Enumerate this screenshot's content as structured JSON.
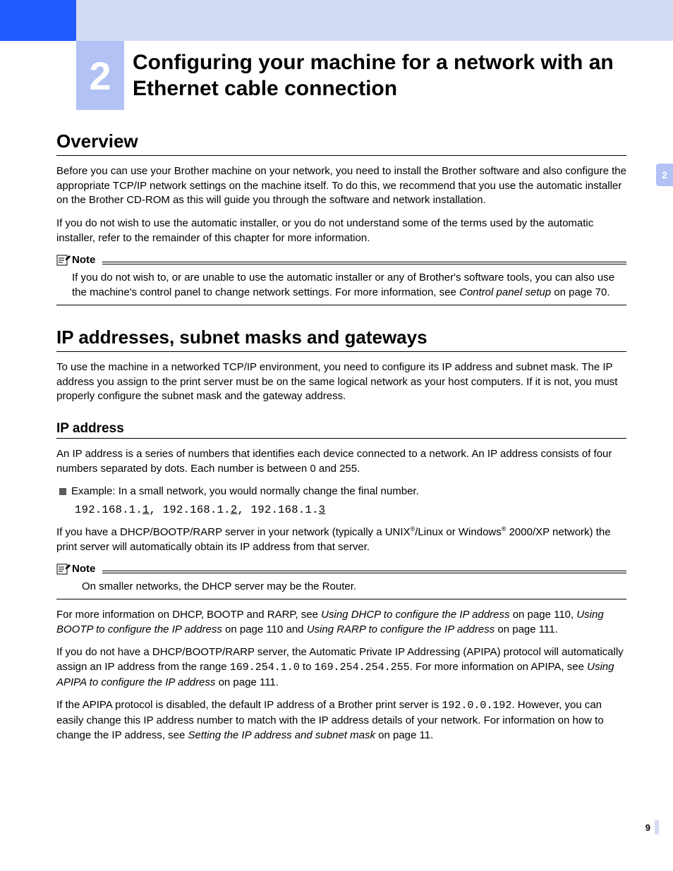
{
  "chapter": {
    "number": "2",
    "title": "Configuring your machine for a network with an Ethernet cable connection"
  },
  "sideTab": "2",
  "pageNumber": "9",
  "overview": {
    "heading": "Overview",
    "p1": "Before you can use your Brother machine on your network, you need to install the Brother software and also configure the appropriate TCP/IP network settings on the machine itself. To do this, we recommend that you use the automatic installer on the Brother CD-ROM as this will guide you through the software and network installation.",
    "p2": "If you do not wish to use the automatic installer, or you do not understand some of the terms used by the automatic installer, refer to the remainder of this chapter for more information.",
    "noteLabel": "Note",
    "note": {
      "pre": "If you do not wish to, or are unable to use the automatic installer or any of Brother's software tools, you can also use the machine's control panel to change network settings. For more information, see ",
      "ref": "Control panel setup",
      "post": " on page 70."
    }
  },
  "ip": {
    "heading": "IP addresses, subnet masks and gateways",
    "intro": "To use the machine in a networked TCP/IP environment, you need to configure its IP address and subnet mask. The IP address you assign to the print server must be on the same logical network as your host computers. If it is not, you must properly configure the subnet mask and the gateway address.",
    "sub": "IP address",
    "sub_p1": "An IP address is a series of numbers that identifies each device connected to a network. An IP address consists of four numbers separated by dots. Each number is between 0 and 255.",
    "bullet": "Example: In a small network, you would normally change the final number.",
    "ipline": {
      "p1a": "192.168.1.",
      "p1u": "1",
      "p2a": "192.168.1.",
      "p2u": "2",
      "p3a": "192.168.1.",
      "p3u": "3",
      "sep": ", "
    },
    "dhcp_p_pre": "If you have a DHCP/BOOTP/RARP server in your network (typically a UNIX",
    "dhcp_p_mid": "/Linux or Windows",
    "dhcp_p_post": " 2000/XP network) the print server will automatically obtain its IP address from that server.",
    "reg": "®",
    "noteLabel": "Note",
    "noteBody": "On smaller networks, the DHCP server may be the Router.",
    "refs": {
      "pre": "For more information on DHCP, BOOTP and RARP, see ",
      "r1": "Using DHCP to configure the IP address",
      "r1post": " on page 110, ",
      "r2": "Using BOOTP to configure the IP address",
      "r2post": " on page 110 and ",
      "r3": "Using RARP to configure the IP address",
      "r3post": " on page 111."
    },
    "apipa": {
      "pre": "If you do not have a DHCP/BOOTP/RARP server, the Automatic Private IP Addressing (APIPA) protocol will automatically assign an IP address from the range ",
      "ip1": "169.254.1.0",
      "mid": " to ",
      "ip2": "169.254.254.255",
      "post1": ". For more information on APIPA, see ",
      "ref": "Using APIPA to configure the IP address",
      "post2": " on page 111."
    },
    "default": {
      "pre": "If the APIPA protocol is disabled, the default IP address of a Brother print server is ",
      "ip": "192.0.0.192",
      "mid": ". However, you can easily change this IP address number to match with the IP address details of your network. For information on how to change the IP address, see ",
      "ref": "Setting the IP address and subnet mask",
      "post": " on page 11."
    }
  }
}
